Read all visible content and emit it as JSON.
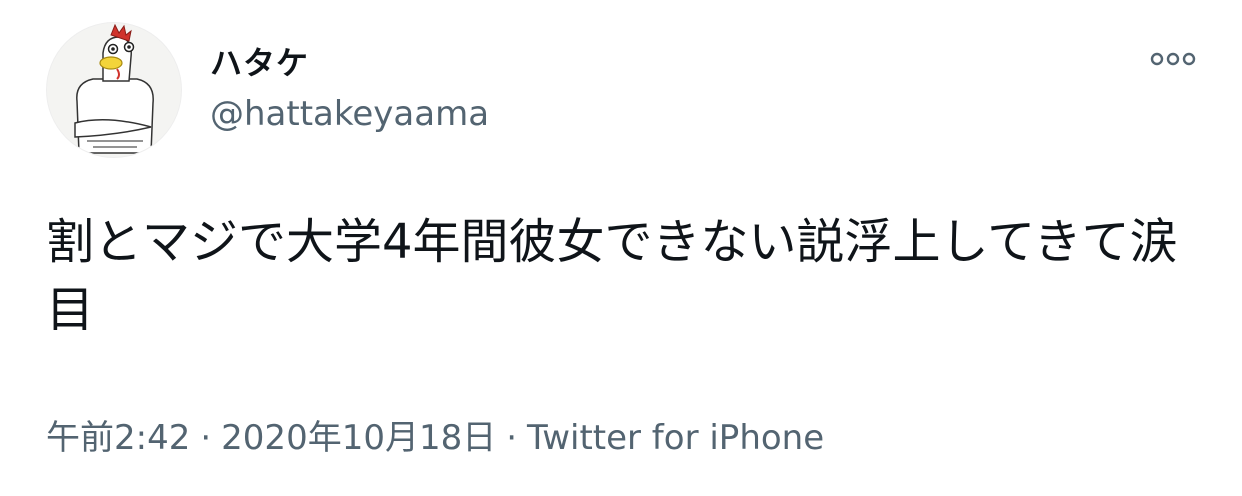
{
  "user": {
    "display_name": "ハタケ",
    "handle": "@hattakeyaama",
    "avatar_icon": "chicken-avatar-icon"
  },
  "actions": {
    "more_icon": "more-options-icon"
  },
  "tweet": {
    "text": "割とマジで大学4年間彼女できない説浮上してきて涙目",
    "time": "午前2:42",
    "separator": "·",
    "date": "2020年10月18日",
    "source": "Twitter for iPhone"
  }
}
